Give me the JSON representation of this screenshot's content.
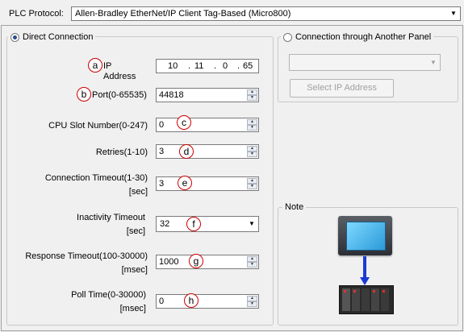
{
  "protocol": {
    "label": "PLC Protocol:",
    "value": "Allen-Bradley EtherNet/IP Client Tag-Based (Micro800)"
  },
  "direct": {
    "label": "Direct Connection",
    "selected": true
  },
  "fields": {
    "ip": {
      "badge": "a",
      "label": "IP Address",
      "octets": [
        "10",
        "11",
        "0",
        "65"
      ]
    },
    "port": {
      "badge": "b",
      "label": "Port(0-65535)",
      "value": "44818"
    },
    "cpu_slot": {
      "badge": "c",
      "label": "CPU Slot Number(0-247)",
      "value": "0"
    },
    "retries": {
      "badge": "d",
      "label": "Retries(1-10)",
      "value": "3"
    },
    "conn_timeout": {
      "badge": "e",
      "label1": "Connection Timeout(1-30)",
      "label2": "[sec]",
      "value": "3"
    },
    "inactivity": {
      "badge": "f",
      "label1": "Inactivity Timeout",
      "label2": "[sec]",
      "value": "32"
    },
    "response_timeout": {
      "badge": "g",
      "label1": "Response Timeout(100-30000)",
      "label2": "[msec]",
      "value": "1000"
    },
    "poll_time": {
      "badge": "h",
      "label1": "Poll Time(0-30000)",
      "label2": "[msec]",
      "value": "0"
    }
  },
  "other_panel": {
    "label": "Connection through Another Panel",
    "selected": false,
    "combo_value": "",
    "select_ip_label": "Select IP Address"
  },
  "note": {
    "title": "Note"
  },
  "colors": {
    "badge_border": "#cc0000",
    "arrow": "#1a3ad6",
    "screen": "#3aaee8"
  }
}
